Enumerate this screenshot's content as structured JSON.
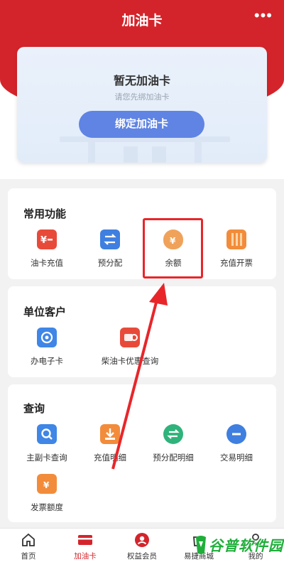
{
  "header": {
    "title": "加油卡",
    "more_icon": "more-dots-icon"
  },
  "card_empty": {
    "title": "暂无加油卡",
    "subtitle": "请您先绑加油卡",
    "button": "绑定加油卡"
  },
  "common": {
    "title": "常用功能",
    "items": [
      {
        "label": "油卡充值",
        "icon": "recharge-card-icon"
      },
      {
        "label": "预分配",
        "icon": "allocate-icon"
      },
      {
        "label": "余额",
        "icon": "money-bag-icon"
      },
      {
        "label": "充值开票",
        "icon": "invoice-icon"
      }
    ]
  },
  "unit": {
    "title": "单位客户",
    "items": [
      {
        "label": "办电子卡",
        "icon": "e-card-icon"
      },
      {
        "label": "柴油卡优惠查询",
        "icon": "diesel-card-icon"
      }
    ]
  },
  "query": {
    "title": "查询",
    "items": [
      {
        "label": "主副卡查询",
        "icon": "card-search-icon"
      },
      {
        "label": "充值明细",
        "icon": "recharge-detail-icon"
      },
      {
        "label": "预分配明细",
        "icon": "allocate-detail-icon"
      },
      {
        "label": "交易明细",
        "icon": "transaction-icon"
      },
      {
        "label": "发票额度",
        "icon": "invoice-quota-icon"
      }
    ]
  },
  "tabbar": [
    {
      "label": "首页",
      "icon": "home-icon"
    },
    {
      "label": "加油卡",
      "icon": "fuel-card-icon",
      "active": true
    },
    {
      "label": "权益会员",
      "icon": "member-icon"
    },
    {
      "label": "易捷商城",
      "icon": "mall-icon"
    },
    {
      "label": "我的",
      "icon": "profile-icon"
    }
  ],
  "watermark": {
    "text": "谷普软件园"
  },
  "colors": {
    "brand_red": "#d4242b",
    "button_blue": "#5f84e3",
    "highlight_red": "#e8262a"
  }
}
